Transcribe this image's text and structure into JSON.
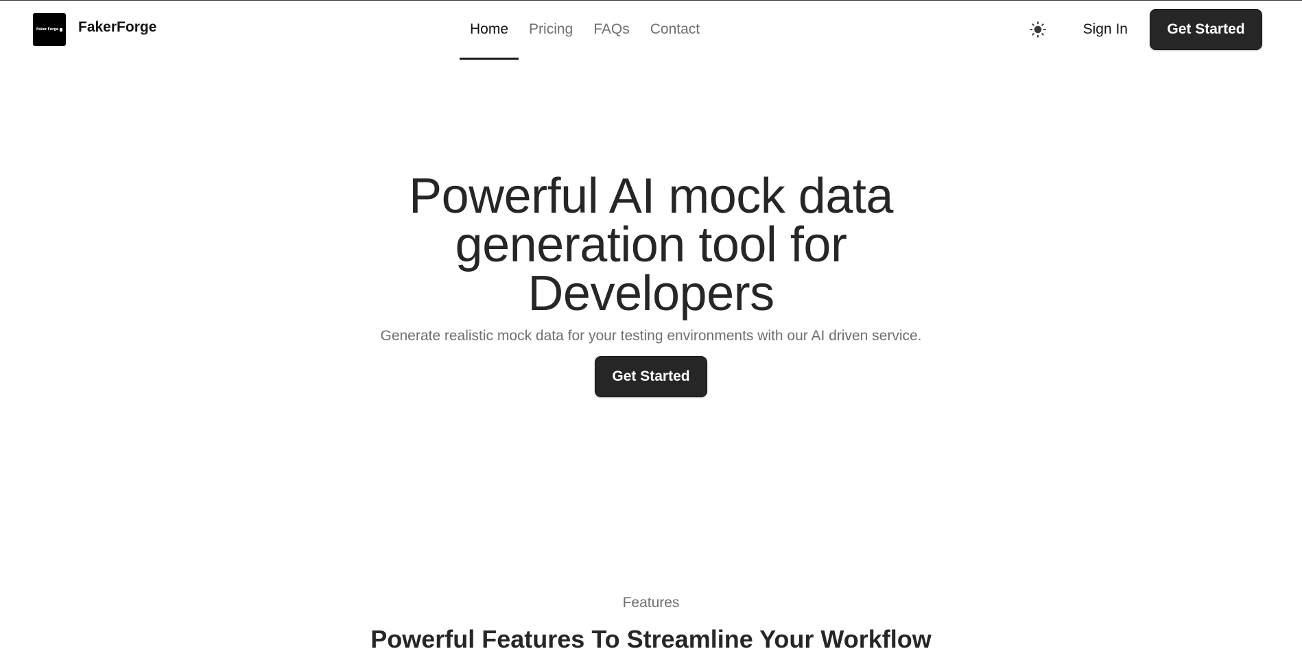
{
  "brand": {
    "logo_text": "Faker Forge",
    "name": "FakerForge"
  },
  "nav": {
    "items": [
      {
        "label": "Home",
        "active": true
      },
      {
        "label": "Pricing",
        "active": false
      },
      {
        "label": "FAQs",
        "active": false
      },
      {
        "label": "Contact",
        "active": false
      }
    ]
  },
  "header_actions": {
    "theme_icon": "sun-icon",
    "sign_in_label": "Sign In",
    "get_started_label": "Get Started"
  },
  "hero": {
    "title": "Powerful AI mock data generation tool for Developers",
    "subtitle": "Generate realistic mock data for your testing environments with our AI driven service.",
    "cta_label": "Get Started"
  },
  "features": {
    "eyebrow": "Features",
    "title": "Powerful Features To Streamline Your Workflow"
  },
  "colors": {
    "primary_button": "#262626",
    "text_dark": "#262626",
    "text_muted": "#6f6f6f",
    "background": "#ffffff"
  }
}
